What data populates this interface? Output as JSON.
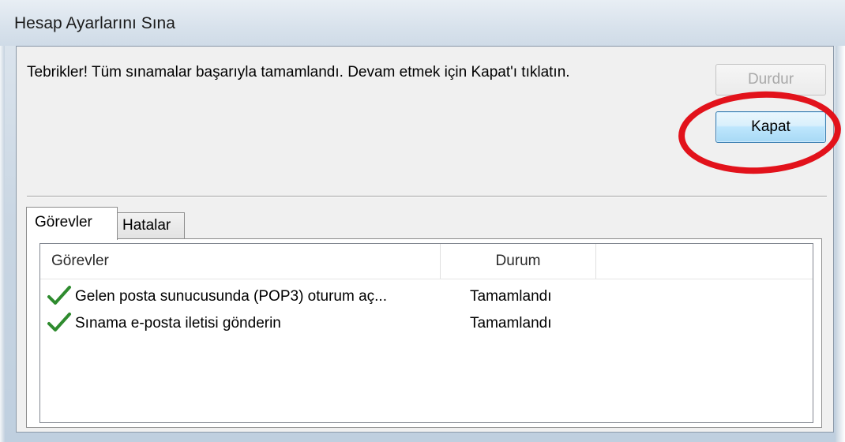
{
  "window": {
    "title": "Hesap Ayarlarını Sına"
  },
  "message": "Tebrikler! Tüm sınamalar başarıyla tamamlandı. Devam etmek için Kapat'ı tıklatın.",
  "buttons": {
    "stop_label": "Durdur",
    "close_label": "Kapat"
  },
  "tabs": [
    {
      "label": "Görevler",
      "active": true
    },
    {
      "label": "Hatalar",
      "active": false
    }
  ],
  "table": {
    "columns": [
      "Görevler",
      "Durum"
    ],
    "rows": [
      {
        "task": "Gelen posta sunucusunda (POP3) oturum aç...",
        "status": "Tamamlandı",
        "icon": "check-icon"
      },
      {
        "task": "Sınama e-posta iletisi gönderin",
        "status": "Tamamlandı",
        "icon": "check-icon"
      }
    ]
  },
  "colors": {
    "highlight_ring": "#e2121b",
    "check": "#2e8b2e",
    "default_button_border": "#3c7fb1"
  }
}
